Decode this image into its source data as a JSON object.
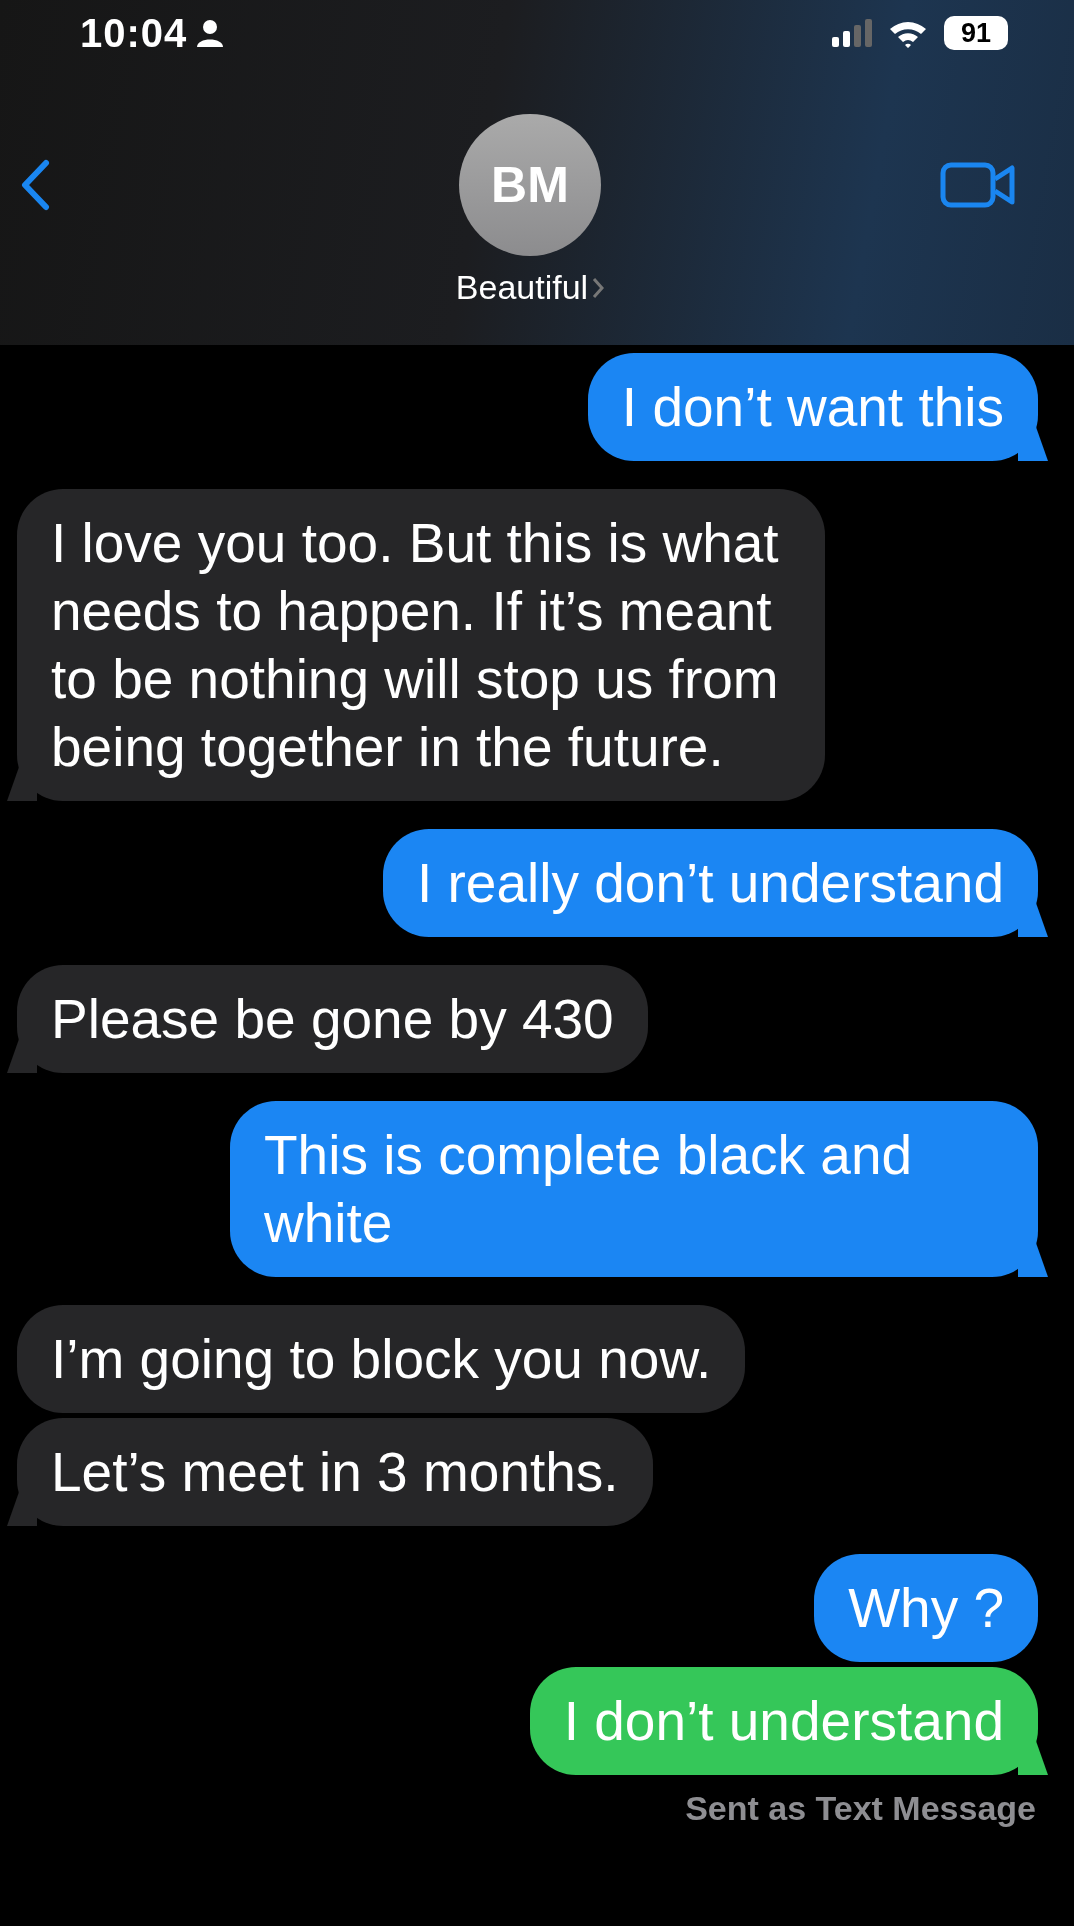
{
  "status_bar": {
    "time": "10:04",
    "battery": "91"
  },
  "header": {
    "avatar_initials": "BM",
    "contact_name": "Beautiful"
  },
  "messages": [
    {
      "kind": "sent",
      "text": "I don’t want this"
    },
    {
      "kind": "received",
      "text": "I love you too. But this is what needs to happen. If it’s meant to be nothing will stop us from being together in the future."
    },
    {
      "kind": "sent",
      "text": "I really don’t understand"
    },
    {
      "kind": "received",
      "text": "Please be gone by 430"
    },
    {
      "kind": "sent",
      "text": "This is complete black and white"
    },
    {
      "kind": "received",
      "text": "I’m going to block you now."
    },
    {
      "kind": "received",
      "text": "Let’s meet in 3 months."
    },
    {
      "kind": "sent",
      "text": "Why ?"
    },
    {
      "kind": "sent-sms",
      "text": "I don’t understand"
    }
  ],
  "footer": "Sent as Text Message"
}
